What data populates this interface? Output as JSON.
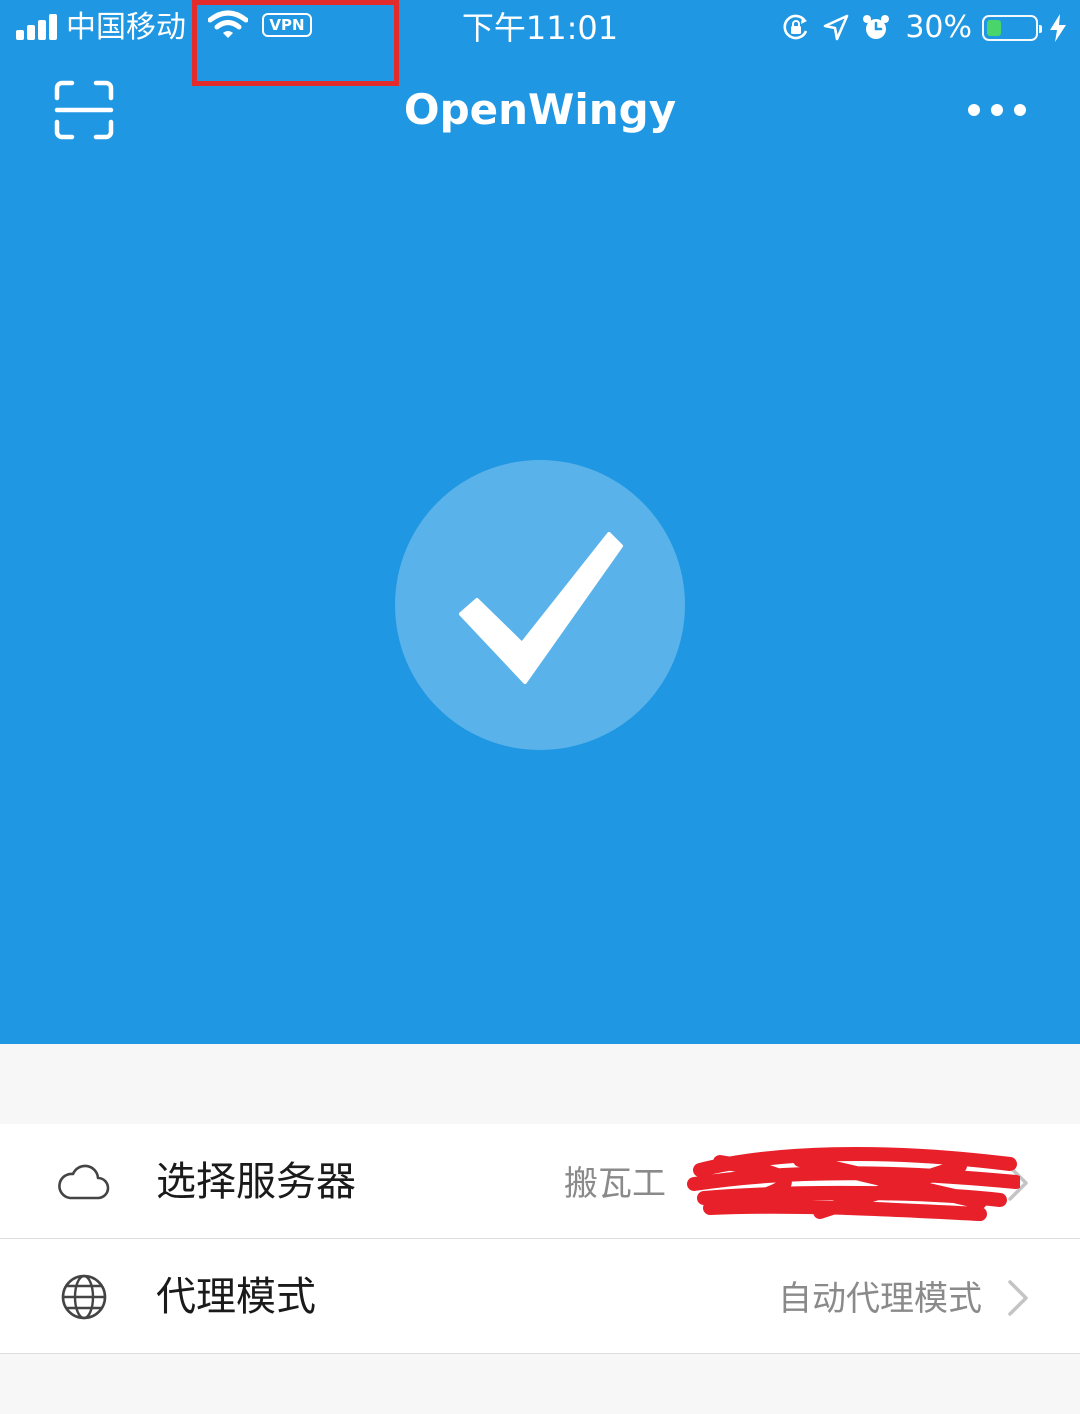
{
  "status_bar": {
    "carrier": "中国移动",
    "vpn": "VPN",
    "time": "下午11:01",
    "battery_percent": "30%",
    "battery_level": 0.3,
    "signal_bars": 4,
    "icons": [
      "signal-icon",
      "wifi-icon",
      "orientation-lock-icon",
      "location-icon",
      "alarm-icon",
      "battery-icon",
      "charging-icon"
    ]
  },
  "nav": {
    "title": "OpenWingy",
    "left_icon": "scan-icon",
    "right_icon": "more-icon"
  },
  "connect": {
    "icon": "checkmark-icon",
    "connected": true
  },
  "settings": [
    {
      "icon": "cloud-icon",
      "label": "选择服务器",
      "value": "搬瓦工"
    },
    {
      "icon": "globe-icon",
      "label": "代理模式",
      "value": "自动代理模式"
    }
  ],
  "colors": {
    "primary": "#1f97e2",
    "connect_circle": "#5ab2ea",
    "highlight_box": "#e32b2b",
    "battery_fill": "#4cd964",
    "list_background": "#ffffff",
    "page_background": "#f7f7f7"
  }
}
